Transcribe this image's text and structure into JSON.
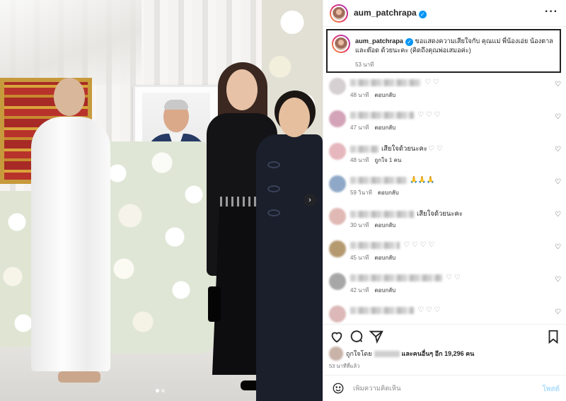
{
  "post": {
    "username": "aum_patchrapa",
    "caption": "ขอแสดงความเสียใจกับ คุณแม่ พี่น้องเอ่ย น้องตาล และต๊อด ด้วยนะคะ (คิดถึงคุณพ่อเสมอค่ะ)",
    "caption_time": "53 นาที",
    "more_icon": "more-horizontal-icon",
    "verified_icon": "verified-badge-icon"
  },
  "carousel": {
    "next_icon": "chevron-right-icon",
    "slide_count": 2,
    "active_slide": 1
  },
  "comments": [
    {
      "text": "",
      "emoji": "♡ ♡",
      "time": "48 นาที",
      "reply": "ตอบกลับ",
      "likes": "",
      "avatar_color": "#d7d0d3",
      "name_width": 100
    },
    {
      "text": "",
      "emoji": "♡ ♡ ♡",
      "time": "47 นาที",
      "reply": "ตอบกลับ",
      "likes": "",
      "avatar_color": "#d3a3b8",
      "name_width": 90
    },
    {
      "text": "เสียใจด้วยนะคะ",
      "emoji": "♡ ♡",
      "time": "48 นาที",
      "reply": "",
      "likes": "ถูกใจ 1 คน",
      "avatar_color": "#e6b7bc",
      "name_width": 40
    },
    {
      "text": "🙏🙏🙏",
      "emoji": "",
      "time": "59 วินาที",
      "reply": "ตอบกลับ",
      "likes": "",
      "avatar_color": "#8fa8c7",
      "name_width": 80
    },
    {
      "text": "เสียใจด้วยนะคะ",
      "emoji": "",
      "time": "30 นาที",
      "reply": "ตอบกลับ",
      "likes": "",
      "avatar_color": "#e0b8b4",
      "name_width": 90
    },
    {
      "text": "",
      "emoji": "♡ ♡ ♡ ♡",
      "time": "45 นาที",
      "reply": "ตอบกลับ",
      "likes": "",
      "avatar_color": "#b59a70",
      "name_width": 70
    },
    {
      "text": "",
      "emoji": "♡ ♡",
      "time": "42 นาที",
      "reply": "ตอบกลับ",
      "likes": "",
      "avatar_color": "#a7a7a7",
      "name_width": 130
    },
    {
      "text": "",
      "emoji": "♡ ♡ ♡",
      "time": "",
      "reply": "",
      "likes": "",
      "avatar_color": "#dcb8b8",
      "name_width": 90
    }
  ],
  "actions": {
    "like_icon": "heart-icon",
    "comment_icon": "comment-icon",
    "share_icon": "send-icon",
    "save_icon": "bookmark-icon"
  },
  "likes": {
    "prefix": "ถูกใจโดย",
    "suffix": "และคนอื่นๆ อีก 19,296 คน"
  },
  "post_time": "53 นาทีที่แล้ว",
  "add_comment": {
    "placeholder": "เพิ่มความคิดเห็น",
    "post_label": "โพสต์",
    "emoji_icon": "smile-icon"
  }
}
